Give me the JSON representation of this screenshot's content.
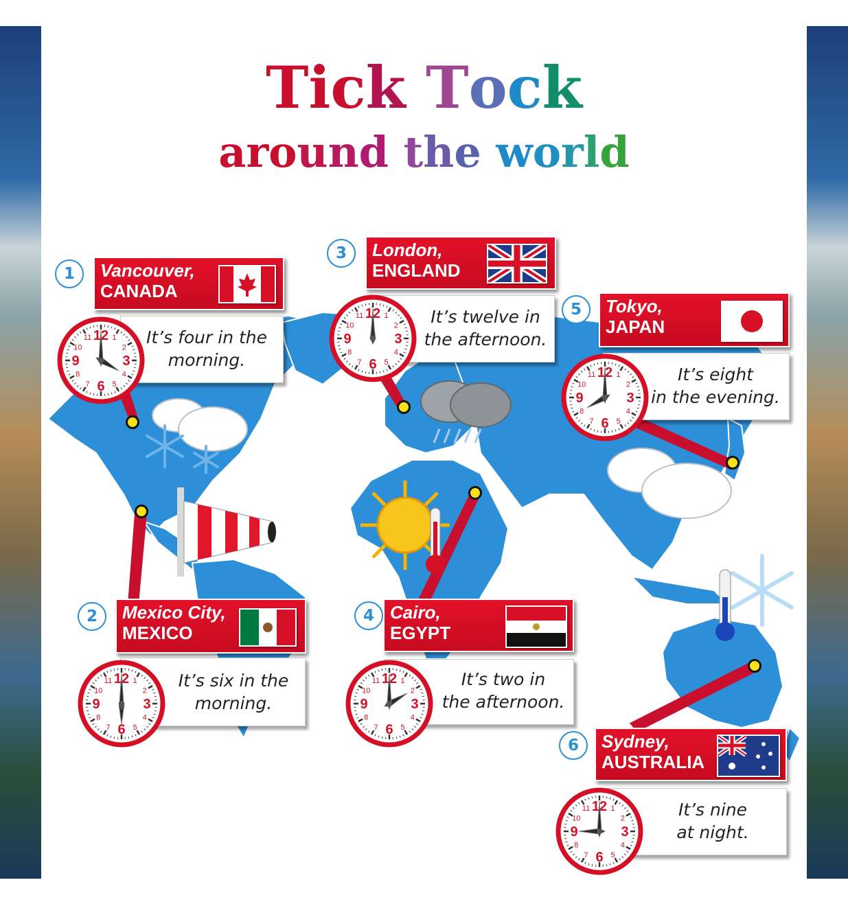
{
  "title": {
    "line1": [
      "T",
      "i",
      "c",
      "k",
      " ",
      "T",
      "o",
      "c",
      "k"
    ],
    "line1_colors": [
      "#c8102e",
      "#c8102e",
      "#c8102e",
      "#b01552",
      "#ffffff",
      "#a0458f",
      "#5a6fb5",
      "#1f8ac8",
      "#128f6a"
    ],
    "line2": [
      "a",
      "r",
      "o",
      "u",
      "n",
      "d",
      " ",
      "t",
      "h",
      "e",
      " ",
      "w",
      "o",
      "r",
      "l",
      "d"
    ],
    "line2_colors": [
      "#c8102e",
      "#c8102e",
      "#c8102e",
      "#c01648",
      "#b81a60",
      "#b01a70",
      "#ffffff",
      "#8e4a98",
      "#6a5aa8",
      "#5a62ae",
      "#ffffff",
      "#1f8ac8",
      "#1f8fc0",
      "#2796a8",
      "#2ba070",
      "#35a43a"
    ]
  },
  "colors": {
    "label_red": "#d50f25",
    "ocean_land_blue": "#2d8fd8",
    "badge_blue": "#2a8fd6",
    "pin_yellow": "#f7e11b",
    "clock_red": "#d50f25"
  },
  "locations": [
    {
      "number": "1",
      "city": "Vancouver,",
      "country": "CANADA",
      "flag": "canada-flag",
      "hour": 4,
      "minute": 0,
      "caption": [
        "It’s four in the",
        "morning."
      ],
      "weather": "snow-cloud-icon"
    },
    {
      "number": "2",
      "city": "Mexico City,",
      "country": "MEXICO",
      "flag": "mexico-flag",
      "hour": 6,
      "minute": 0,
      "caption": [
        "It’s six in the",
        "morning."
      ],
      "weather": "windsock-icon"
    },
    {
      "number": "3",
      "city": "London,",
      "country": "ENGLAND",
      "flag": "union-jack-flag",
      "hour": 12,
      "minute": 0,
      "caption": [
        "It’s twelve in",
        "the afternoon."
      ],
      "weather": "rain-cloud-icon"
    },
    {
      "number": "4",
      "city": "Cairo,",
      "country": "EGYPT",
      "flag": "egypt-flag",
      "hour": 2,
      "minute": 0,
      "caption": [
        "It’s two in",
        "the afternoon."
      ],
      "weather": "sun-thermometer-icon"
    },
    {
      "number": "5",
      "city": "Tokyo,",
      "country": "JAPAN",
      "flag": "japan-flag",
      "hour": 8,
      "minute": 0,
      "caption": [
        "It’s eight",
        "in the evening."
      ],
      "weather": "cloud-icon"
    },
    {
      "number": "6",
      "city": "Sydney,",
      "country": "AUSTRALIA",
      "flag": "australia-flag",
      "hour": 9,
      "minute": 0,
      "caption": [
        "It’s nine",
        "at night."
      ],
      "weather": "cold-thermometer-icon"
    }
  ],
  "clock_numbers": [
    "12",
    "1",
    "2",
    "3",
    "4",
    "5",
    "6",
    "7",
    "8",
    "9",
    "10",
    "11"
  ]
}
